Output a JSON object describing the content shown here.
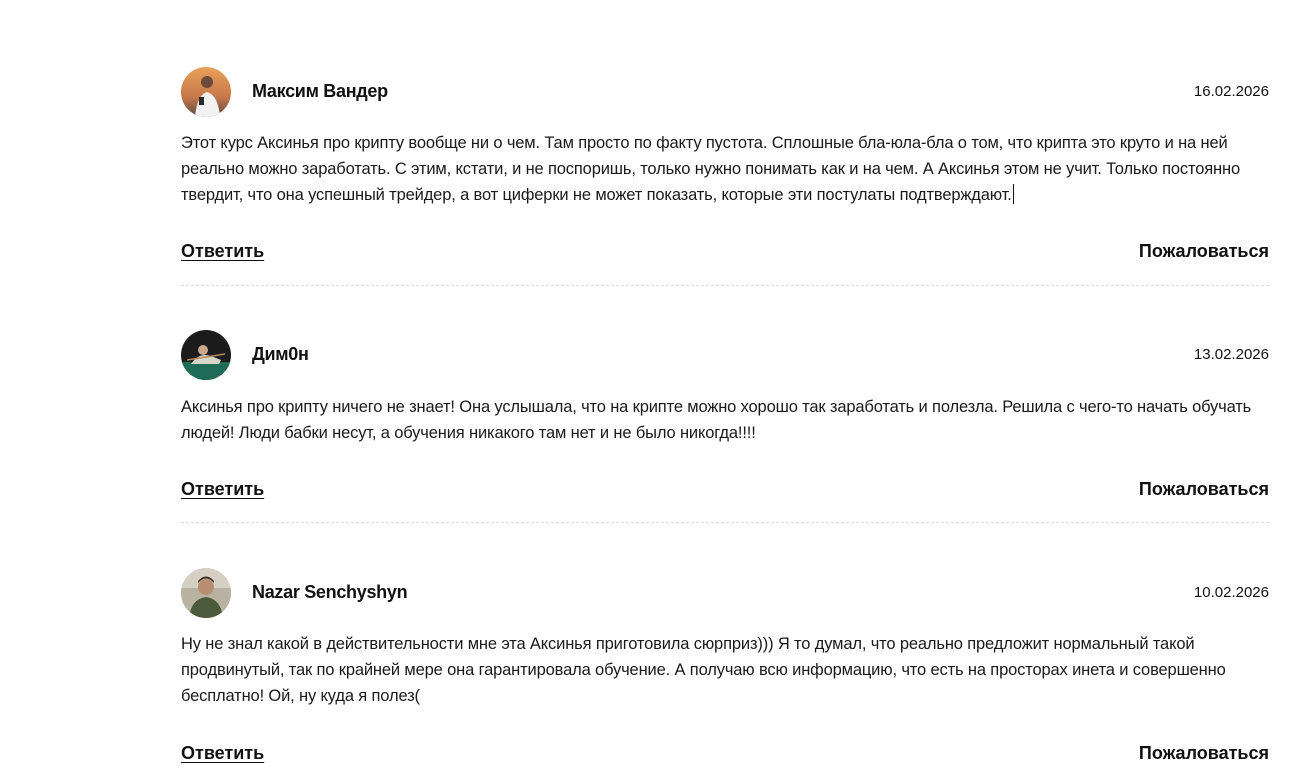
{
  "comments": [
    {
      "author": "Максим Вандер",
      "date": "16.02.2026",
      "text": "Этот курс Аксинья про крипту вообще ни о чем. Там просто по факту пустота. Сплошные бла-юла-бла о том, что крипта это круто и на ней реально можно заработать. С этим, кстати, и не поспоришь, только нужно понимать как и на чем. А Аксинья этом не учит. Только постоянно твердит, что она успешный трейдер, а вот циферки не может показать, которые эти постулаты подтверждают.",
      "reply_label": "Ответить",
      "report_label": "Пожаловаться"
    },
    {
      "author": "Дим0н",
      "date": "13.02.2026",
      "text": "Аксинья про крипту ничего не знает! Она услышала, что на крипте можно хорошо так заработать и полезла. Решила с чего-то начать обучать людей! Люди бабки несут, а обучения никакого там нет и не было никогда!!!!",
      "reply_label": "Ответить",
      "report_label": "Пожаловаться"
    },
    {
      "author": "Nazar Senchyshyn",
      "date": "10.02.2026",
      "text": "Ну не знал какой в действительности мне эта Аксинья приготовила сюрприз))) Я то думал, что реально предложит нормальный такой продвинутый, так по крайней мере она гарантировала обучение. А получаю всю информацию, что есть на просторах инета и совершенно бесплатно! Ой, ну куда я полез(",
      "reply_label": "Ответить",
      "report_label": "Пожаловаться"
    }
  ]
}
